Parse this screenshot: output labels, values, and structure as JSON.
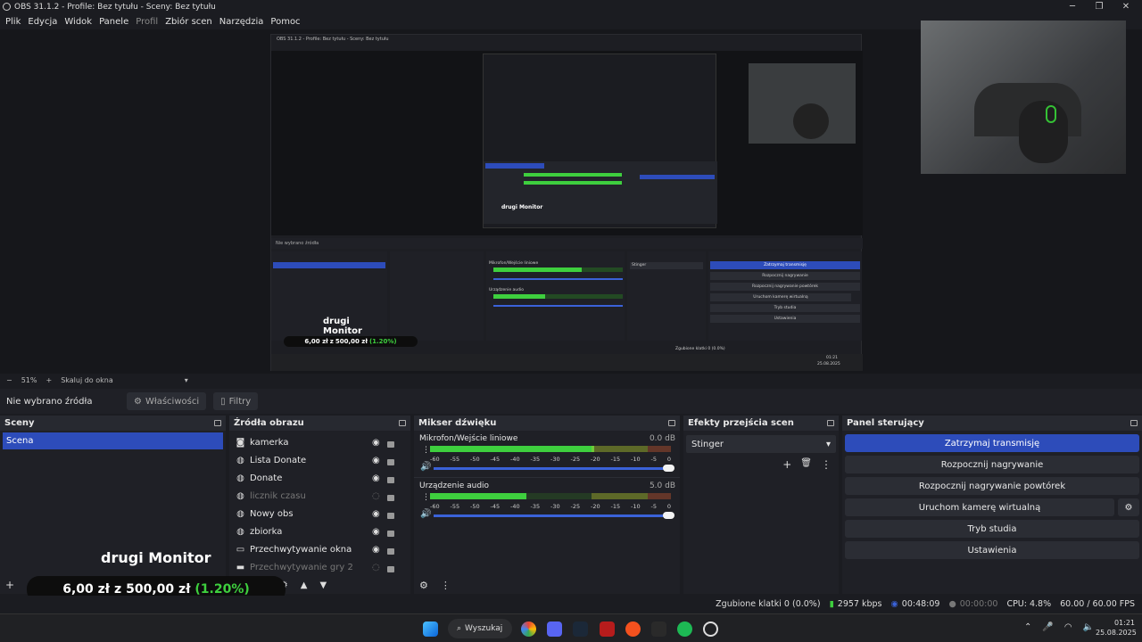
{
  "window": {
    "title": "OBS 31.1.2 - Profile: Bez tytułu - Sceny: Bez tytułu"
  },
  "menu": {
    "items": [
      "Plik",
      "Edycja",
      "Widok",
      "Panele",
      "Profil",
      "Zbiór scen",
      "Narzędzia",
      "Pomoc"
    ]
  },
  "preview": {
    "nested_title": "OBS 31.1.2 - Profile: Bez tytułu - Sceny: Bez tytułu",
    "monitor_label": "drugi Monitor",
    "nested_amount": "6,00 zł",
    "nested_of": "z",
    "nested_goal": "500,00 zł",
    "nested_pct": "(1.20%)",
    "nested_mic": "Mikrofon/Wejście liniowe",
    "nested_audio": "Urządzenie audio",
    "nested_stinger": "Stinger",
    "nested_ctl": [
      "Zatrzymaj transmisję",
      "Rozpocznij nagrywanie",
      "Rozpocznij nagrywanie powtórek",
      "Uruchom kamerę wirtualną",
      "Tryb studia",
      "Ustawienia"
    ],
    "nested_time": "01:21",
    "nested_date": "25.08.2025",
    "nested_status": "Zgubione klatki 0 (0.0%)"
  },
  "zoom": {
    "value": "51%",
    "mode": "Skaluj do okna"
  },
  "source_bar": {
    "none_selected": "Nie wybrano źródła",
    "properties": "Właściwości",
    "filters": "Filtry"
  },
  "scenes": {
    "title": "Sceny",
    "items": [
      "Scena"
    ]
  },
  "sources": {
    "title": "Źródła obrazu",
    "items": [
      {
        "name": "kamerka",
        "icon": "camera-icon",
        "visible": true
      },
      {
        "name": "Lista Donate",
        "icon": "globe-icon",
        "visible": true
      },
      {
        "name": "Donate",
        "icon": "globe-icon",
        "visible": true
      },
      {
        "name": "licznik czasu",
        "icon": "globe-icon",
        "visible": false
      },
      {
        "name": "Nowy obs",
        "icon": "globe-icon",
        "visible": true
      },
      {
        "name": "zbiorka",
        "icon": "globe-icon",
        "visible": true
      },
      {
        "name": "Przechwytywanie okna",
        "icon": "window-icon",
        "visible": true
      },
      {
        "name": "Przechwytywanie gry 2",
        "icon": "gamepad-icon",
        "visible": false
      }
    ]
  },
  "mixer": {
    "title": "Mikser dźwięku",
    "channels": [
      {
        "name": "Mikrofon/Wejście liniowe",
        "db": "0.0 dB",
        "level": 0.68
      },
      {
        "name": "Urządzenie audio",
        "db": "5.0 dB",
        "level": 0.4
      }
    ],
    "ticks": [
      "-60",
      "-55",
      "-50",
      "-45",
      "-40",
      "-35",
      "-30",
      "-25",
      "-20",
      "-15",
      "-10",
      "-5",
      "0"
    ]
  },
  "transitions": {
    "title": "Efekty przejścia scen",
    "selected": "Stinger"
  },
  "controls": {
    "title": "Panel sterujący",
    "buttons": [
      "Zatrzymaj transmisję",
      "Rozpocznij nagrywanie",
      "Rozpocznij nagrywanie powtórek",
      "Uruchom kamerę wirtualną",
      "Tryb studia",
      "Ustawienia"
    ]
  },
  "overlay": {
    "monitor_label": "drugi Monitor",
    "amount": "6,00 zł",
    "of": "z",
    "goal": "500,00 zł",
    "pct": "(1.20%)"
  },
  "status": {
    "dropped": "Zgubione klatki 0 (0.0%)",
    "kbps": "2957 kbps",
    "stream_time": "00:48:09",
    "rec_time": "00:00:00",
    "cpu": "CPU: 4.8%",
    "fps": "60.00 / 60.00 FPS"
  },
  "taskbar": {
    "search": "Wyszukaj",
    "time": "01:21",
    "date": "25.08.2025"
  },
  "colors": {
    "accent": "#2d4cba",
    "meter_green": "#3ecf3e",
    "meter_yellow": "#c9c232",
    "meter_red": "#c43333"
  }
}
